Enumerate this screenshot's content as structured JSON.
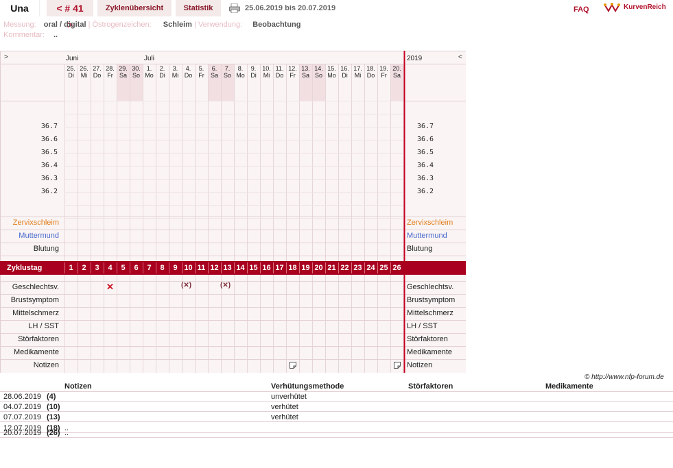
{
  "header": {
    "user": "Una",
    "cycle_nav": "< # 41 >",
    "tab_overview": "Zyklenübersicht",
    "tab_stats": "Statistik",
    "date_range": "25.06.2019 bis 20.07.2019",
    "faq": "FAQ",
    "logo": "KurvenReich"
  },
  "meta": {
    "messung_label": "Messung:",
    "messung_value": "oral / digital",
    "oestrogen_label": "Östrogenzeichen:",
    "oestrogen_value": "Schleim",
    "verwendung_label": "Verwendung:",
    "verwendung_value": "Beobachtung",
    "kommentar_label": "Kommentar:",
    "kommentar_value": ".."
  },
  "chart": {
    "nav_left": ">",
    "nav_right": "<",
    "year": "2019",
    "months": [
      {
        "label": "Juni",
        "day_index": 0
      },
      {
        "label": "Juli",
        "day_index": 6
      }
    ],
    "days": [
      {
        "d": "25.",
        "w": "Di",
        "we": false
      },
      {
        "d": "26.",
        "w": "Mi",
        "we": false
      },
      {
        "d": "27.",
        "w": "Do",
        "we": false
      },
      {
        "d": "28.",
        "w": "Fr",
        "we": false
      },
      {
        "d": "29.",
        "w": "Sa",
        "we": true
      },
      {
        "d": "30.",
        "w": "So",
        "we": true
      },
      {
        "d": "1.",
        "w": "Mo",
        "we": false
      },
      {
        "d": "2.",
        "w": "Di",
        "we": false
      },
      {
        "d": "3.",
        "w": "Mi",
        "we": false
      },
      {
        "d": "4.",
        "w": "Do",
        "we": false
      },
      {
        "d": "5.",
        "w": "Fr",
        "we": false
      },
      {
        "d": "6.",
        "w": "Sa",
        "we": true
      },
      {
        "d": "7.",
        "w": "So",
        "we": true
      },
      {
        "d": "8.",
        "w": "Mo",
        "we": false
      },
      {
        "d": "9.",
        "w": "Di",
        "we": false
      },
      {
        "d": "10.",
        "w": "Mi",
        "we": false
      },
      {
        "d": "11.",
        "w": "Do",
        "we": false
      },
      {
        "d": "12.",
        "w": "Fr",
        "we": false
      },
      {
        "d": "13.",
        "w": "Sa",
        "we": true
      },
      {
        "d": "14.",
        "w": "So",
        "we": true
      },
      {
        "d": "15.",
        "w": "Mo",
        "we": false
      },
      {
        "d": "16.",
        "w": "Di",
        "we": false
      },
      {
        "d": "17.",
        "w": "Mi",
        "we": false
      },
      {
        "d": "18.",
        "w": "Do",
        "we": false
      },
      {
        "d": "19.",
        "w": "Fr",
        "we": false
      },
      {
        "d": "20.",
        "w": "Sa",
        "we": true
      }
    ],
    "temps": [
      "36.7",
      "36.6",
      "36.5",
      "36.4",
      "36.3",
      "36.2"
    ],
    "rows_top": [
      {
        "label": "Zervixschleim",
        "color": "orange"
      },
      {
        "label": "Muttermund",
        "color": "blue"
      },
      {
        "label": "Blutung",
        "color": "black"
      }
    ],
    "cycle_label": "Zyklustag",
    "cycle_days": [
      "1",
      "2",
      "3",
      "4",
      "5",
      "6",
      "7",
      "8",
      "9",
      "10",
      "11",
      "12",
      "13",
      "14",
      "15",
      "16",
      "17",
      "18",
      "19",
      "20",
      "21",
      "22",
      "23",
      "24",
      "25",
      "26"
    ],
    "rows_bottom": [
      "Geschlechtsv.",
      "Brustsymptom",
      "Mittelschmerz",
      "LH / SST",
      "Störfaktoren",
      "Medikamente",
      "Notizen"
    ],
    "intercourse": [
      {
        "cycle_day": 4,
        "symbol": "✕"
      },
      {
        "cycle_day": 10,
        "symbol": "(✕)"
      },
      {
        "cycle_day": 13,
        "symbol": "(✕)"
      }
    ],
    "notes_days": [
      18,
      26
    ]
  },
  "copyright": "© http://www.nfp-forum.de",
  "table": {
    "headers": [
      "Notizen",
      "Verhütungsmethode",
      "Störfaktoren",
      "Medikamente"
    ],
    "rows": [
      {
        "date": "28.06.2019",
        "day": "(4)",
        "note": "",
        "method": "unverhütet"
      },
      {
        "date": "04.07.2019",
        "day": "(10)",
        "note": "",
        "method": "verhütet"
      },
      {
        "date": "07.07.2019",
        "day": "(13)",
        "note": "",
        "method": "verhütet"
      },
      {
        "date": "12.07.2019",
        "day": "(18)",
        "note": "..",
        "method": ""
      },
      {
        "date": "20.07.2019",
        "day": "(26)",
        "note": "..",
        "method": ""
      }
    ]
  }
}
